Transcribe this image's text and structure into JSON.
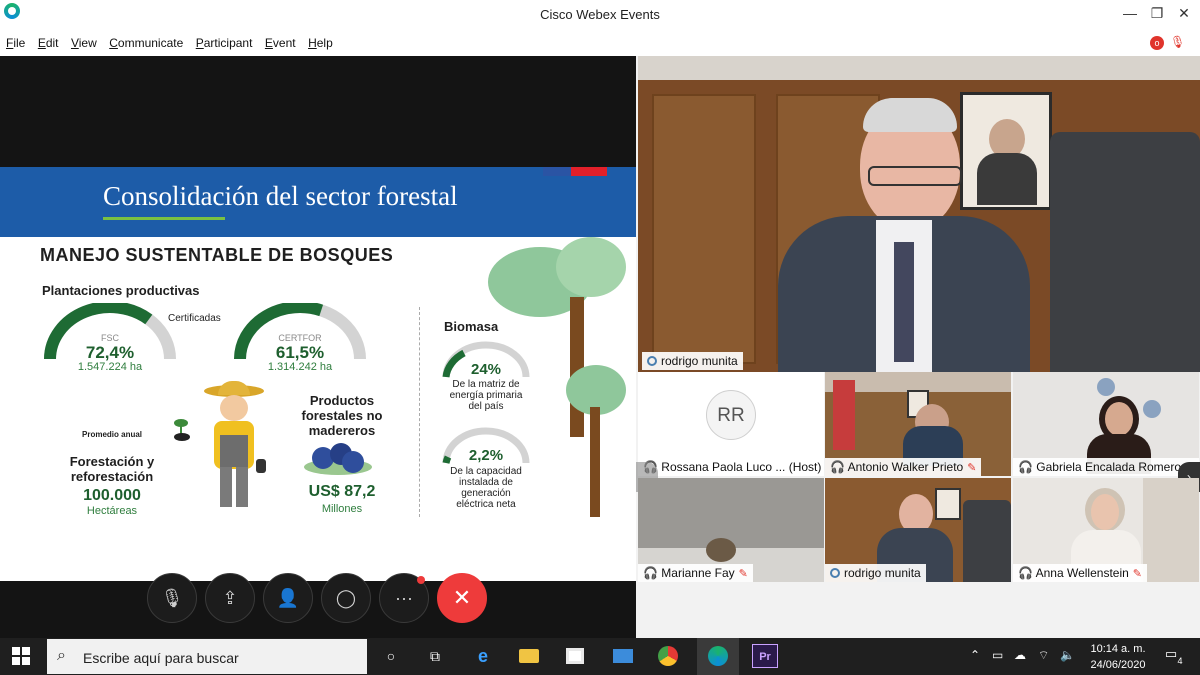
{
  "window": {
    "title": "Cisco Webex Events",
    "minimize_glyph": "—",
    "restore_glyph": "❐",
    "close_glyph": "✕"
  },
  "menu": [
    "File",
    "Edit",
    "View",
    "Communicate",
    "Participant",
    "Event",
    "Help"
  ],
  "top_status": {
    "recording_badge": "o",
    "mute_icon": "microphone-muted-icon"
  },
  "slide": {
    "title": "Consolidación del sector forestal",
    "heading": "MANEJO SUSTENTABLE DE BOSQUES",
    "plantaciones_label": "Plantaciones productivas",
    "certificadas_label": "Certificadas",
    "gauge_fsc": {
      "label": "FSC",
      "value": "72,4%",
      "area": "1.547.224 ha",
      "fraction": 0.724
    },
    "gauge_certfor": {
      "label": "CERTFOR",
      "value": "61,5%",
      "area": "1.314.242 ha",
      "fraction": 0.615
    },
    "biomasa_label": "Biomasa",
    "biomasa_value": "24%",
    "biomasa_desc": [
      "De la matriz de",
      "energía primaria",
      "del país"
    ],
    "capacidad_value": "2,2%",
    "capacidad_desc": [
      "De la capacidad",
      "instalada de",
      "generación",
      "eléctrica neta"
    ],
    "promedio_label": "Promedio anual",
    "forestacion_label": [
      "Forestación y",
      "reforestación"
    ],
    "forestacion_value": "100.000",
    "forestacion_unit": "Hectáreas",
    "productos_label": [
      "Productos",
      "forestales no",
      "madereros"
    ],
    "productos_value": "US$ 87,2",
    "productos_unit": "Millones",
    "colors": {
      "header": "#1d5ca8",
      "green": "#1e6b34",
      "accent": "#7ac142"
    }
  },
  "controls": {
    "mute": "microphone-muted-icon",
    "share": "share-icon",
    "participants": "participants-icon",
    "chat": "chat-icon",
    "more": "more-icon",
    "end": "end-call-icon",
    "mute_glyph": "🎙",
    "share_glyph": "⇪",
    "participants_glyph": "👤",
    "chat_glyph": "◯",
    "more_glyph": "···",
    "end_glyph": "✕"
  },
  "participants": {
    "active_speaker": "rodrigo munita",
    "initials_tile": "RR",
    "tiles": [
      {
        "name": "Rossana Paola Luco ... (Host)"
      },
      {
        "name": "Antonio Walker Prieto"
      },
      {
        "name": "Gabriela Encalada Romero"
      },
      {
        "name": "Marianne Fay"
      },
      {
        "name": "rodrigo munita"
      },
      {
        "name": "Anna Wellenstein"
      }
    ]
  },
  "taskbar": {
    "search_placeholder": "Escribe aquí para buscar",
    "time": "10:14 a. m.",
    "date": "24/06/2020",
    "notification_count": "4",
    "premiere_label": "Pr"
  }
}
